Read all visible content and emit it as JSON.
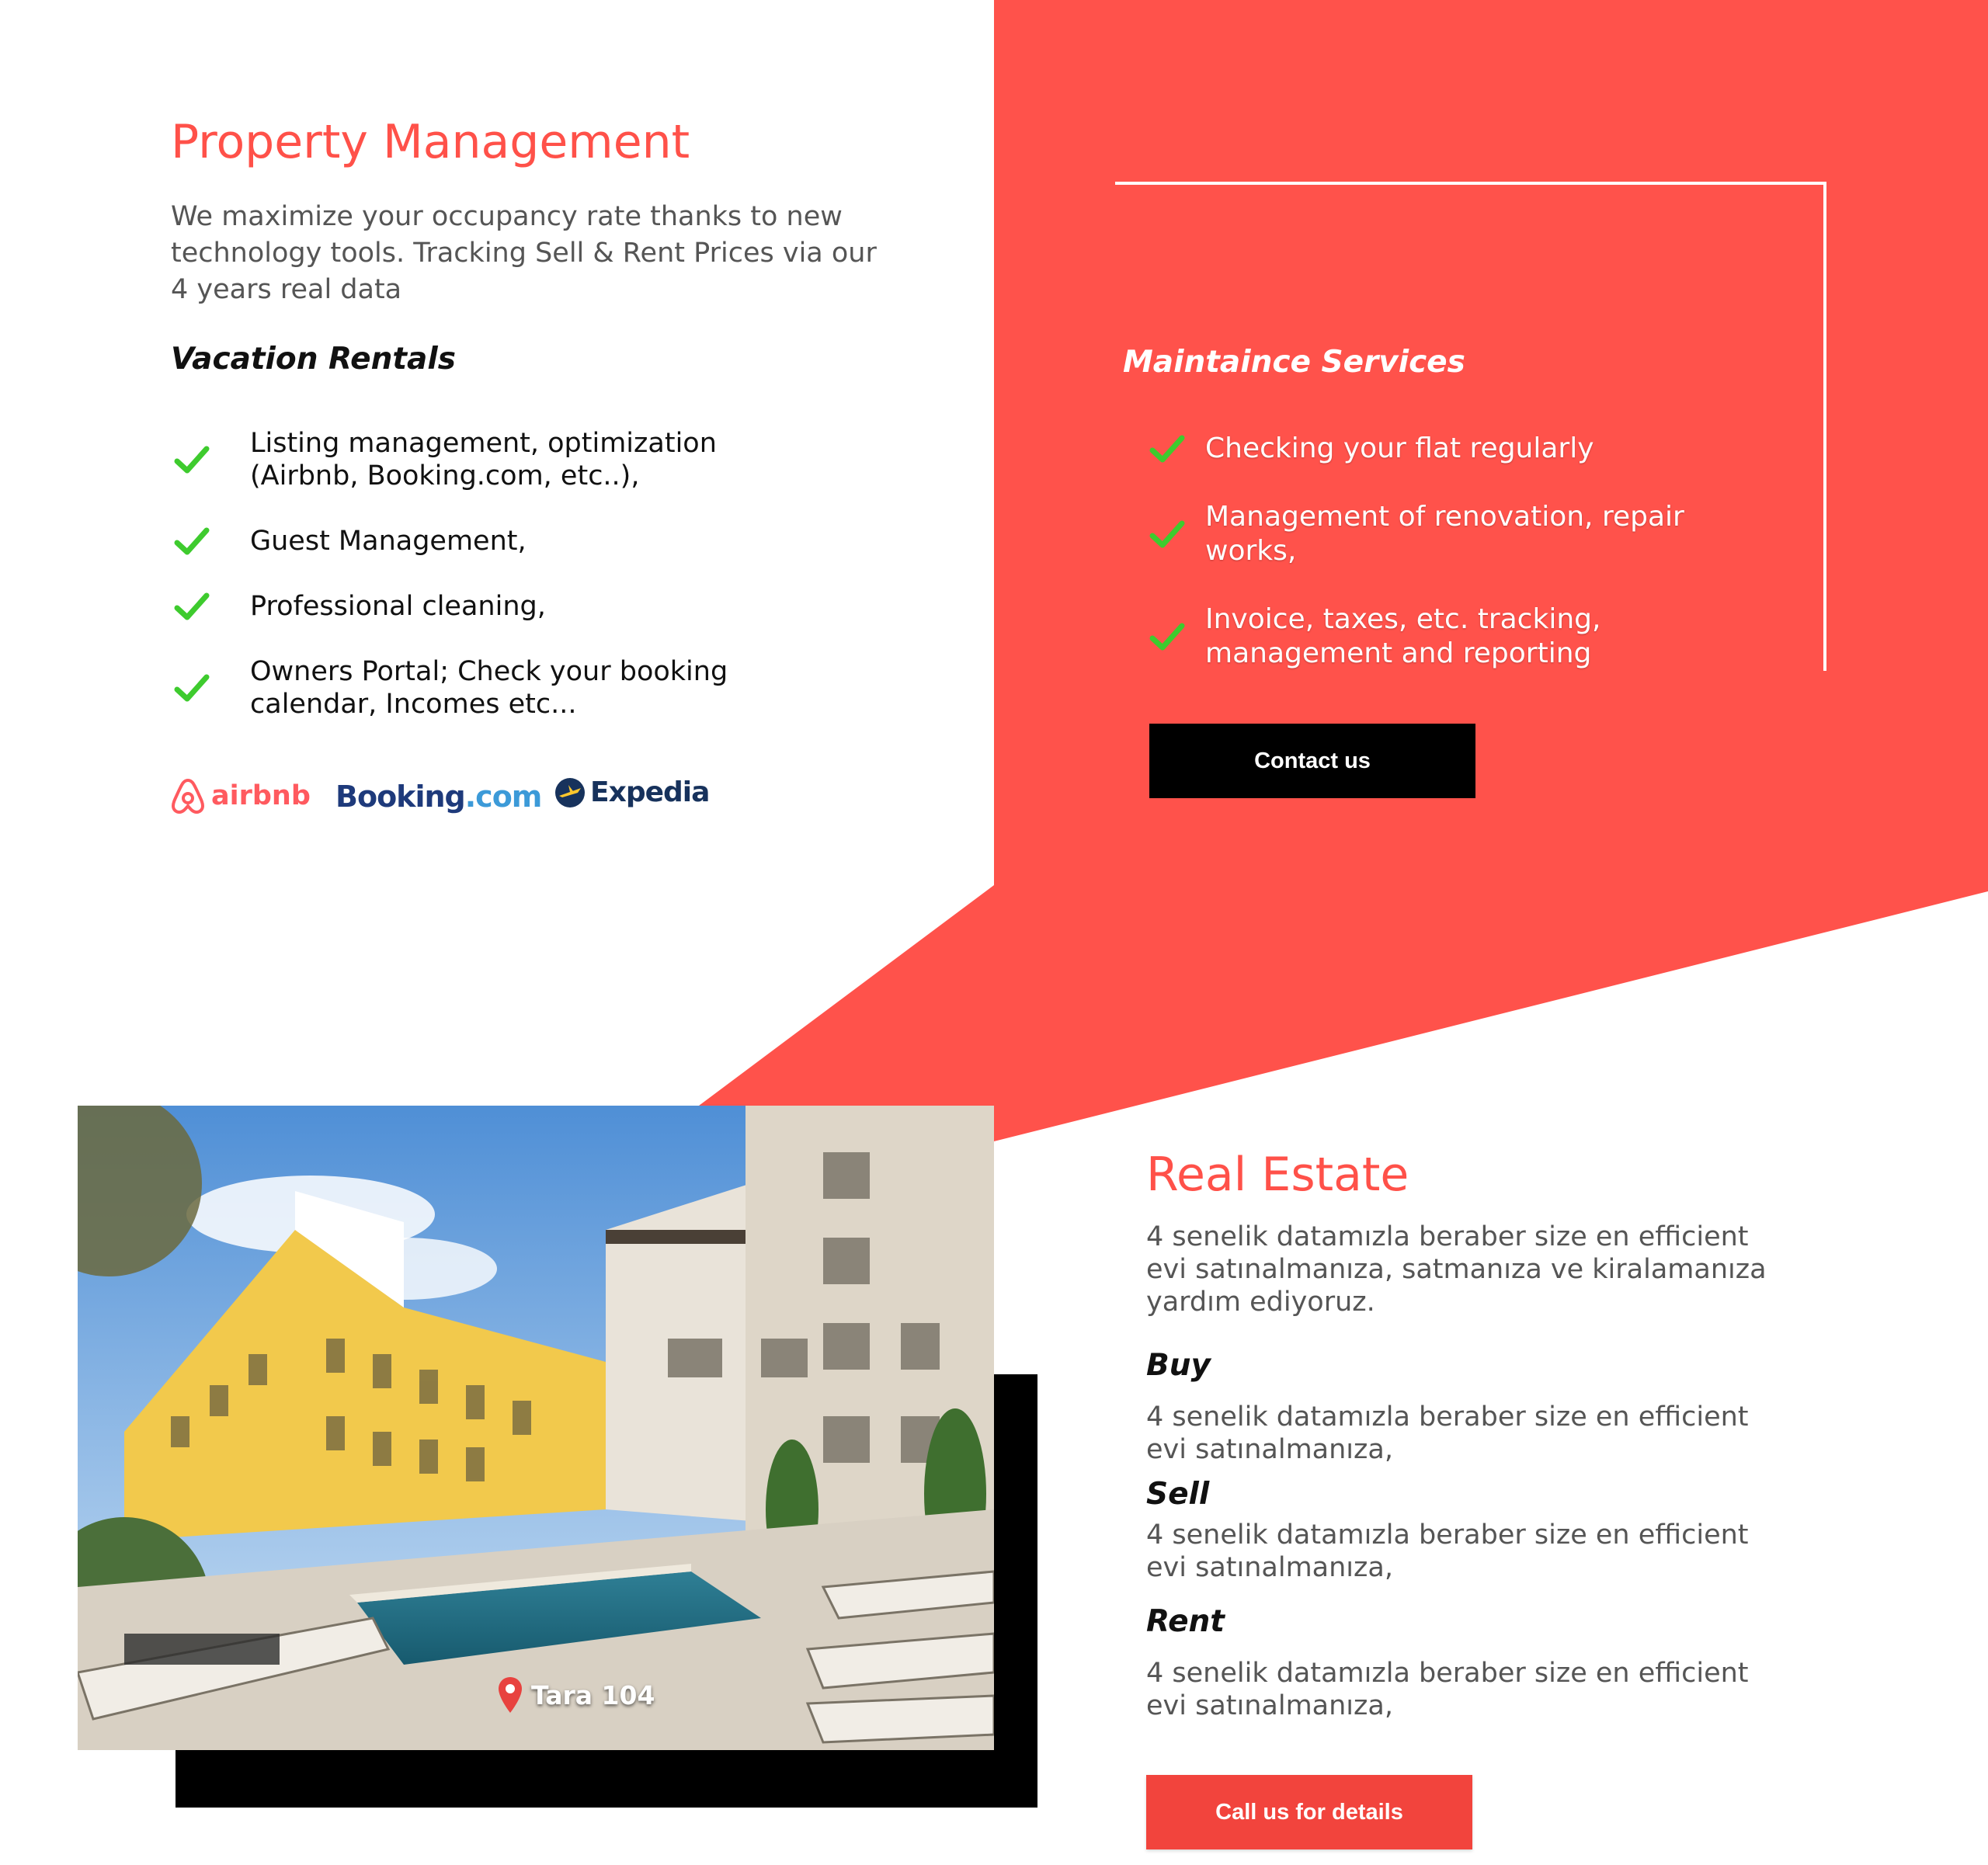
{
  "colors": {
    "accent": "#ff5149",
    "panel_red": "#ff524b",
    "check_green": "#3ecb2e",
    "dark": "#000000"
  },
  "property_management": {
    "title": "Property Management",
    "description": "We maximize your occupancy rate thanks to new technology tools. Tracking Sell & Rent Prices via our 4 years real data",
    "vacation_heading": "Vacation Rentals",
    "items": [
      {
        "label": "Listing management, optimization (Airbnb, Booking.com, etc..),",
        "icon": "check-icon"
      },
      {
        "label": "Guest Management,",
        "icon": "check-icon"
      },
      {
        "label": "Professional cleaning,",
        "icon": "check-icon"
      },
      {
        "label": "Owners Portal; Check your booking calendar, Incomes etc...",
        "icon": "check-icon"
      }
    ],
    "logos": {
      "airbnb": "airbnb",
      "booking_main": "Booking",
      "booking_com": ".com",
      "expedia": "Expedia"
    }
  },
  "maintenance": {
    "heading": "Maintaince Services",
    "items": [
      {
        "label": "Checking your flat regularly",
        "icon": "check-icon"
      },
      {
        "label": "Management of renovation, repair works,",
        "icon": "check-icon"
      },
      {
        "label": "Invoice, taxes, etc. tracking, management and reporting",
        "icon": "check-icon"
      }
    ],
    "contact_label": "Contact us"
  },
  "photo": {
    "location_label": "Tara 104",
    "pin_icon": "location-pin-icon"
  },
  "real_estate": {
    "title": "Real Estate",
    "description": "4 senelik datamızla beraber size en efficient evi satınalmanıza, satmanıza ve kiralamanıza yardım ediyoruz.",
    "sections": [
      {
        "heading": "Buy",
        "text": "4 senelik datamızla beraber size en efficient evi satınalmanıza,"
      },
      {
        "heading": "Sell",
        "text": "4 senelik datamızla beraber size en efficient evi satınalmanıza,"
      },
      {
        "heading": "Rent",
        "text": "4 senelik datamızla beraber size en efficient evi satınalmanıza,"
      }
    ],
    "call_label": "Call us for details"
  }
}
